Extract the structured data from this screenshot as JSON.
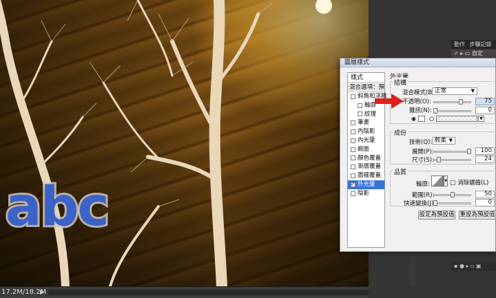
{
  "canvas": {
    "overlay_text": "abc"
  },
  "status_bar": {
    "doc_size": "17.2M/18.2M"
  },
  "right_panel": {
    "tab1": "動作",
    "tab2": "步驟記錄",
    "row_label": "自定"
  },
  "dialog": {
    "title": "圖層樣式",
    "style_list": {
      "header": "樣式",
      "blend_options": "混合選項：預設",
      "items": [
        {
          "label": "斜角和浮雕",
          "checked": false,
          "sub": false,
          "selected": false
        },
        {
          "label": "輪廓",
          "checked": false,
          "sub": true,
          "selected": false
        },
        {
          "label": "紋理",
          "checked": false,
          "sub": true,
          "selected": false
        },
        {
          "label": "筆畫",
          "checked": false,
          "sub": false,
          "selected": false
        },
        {
          "label": "內陰影",
          "checked": false,
          "sub": false,
          "selected": false
        },
        {
          "label": "內光暈",
          "checked": false,
          "sub": false,
          "selected": false
        },
        {
          "label": "緞面",
          "checked": false,
          "sub": false,
          "selected": false
        },
        {
          "label": "顏色覆蓋",
          "checked": false,
          "sub": false,
          "selected": false
        },
        {
          "label": "漸層覆蓋",
          "checked": false,
          "sub": false,
          "selected": false
        },
        {
          "label": "圖樣覆蓋",
          "checked": false,
          "sub": false,
          "selected": false
        },
        {
          "label": "外光暈",
          "checked": true,
          "sub": false,
          "selected": true
        },
        {
          "label": "陰影",
          "checked": false,
          "sub": false,
          "selected": false
        }
      ]
    },
    "outer_glow": {
      "title": "外光暈",
      "structure": {
        "title": "結構",
        "blend_mode_label": "混合模式(B):",
        "blend_mode_value": "正常",
        "opacity_label": "不透明(O):",
        "opacity_value": "75",
        "opacity_fraction": 0.75,
        "noise_label": "雜訊(N):",
        "noise_value": "0",
        "noise_fraction": 0.0
      },
      "elements": {
        "title": "成份",
        "technique_label": "技術(Q):",
        "technique_value": "較柔",
        "spread_label": "展開(P):",
        "spread_value": "100",
        "spread_fraction": 1.0,
        "size_label": "尺寸(S):",
        "size_value": "24",
        "size_fraction": 0.1
      },
      "quality": {
        "title": "品質",
        "contour_label": "輪廓:",
        "antialias_label": "消除鋸齒(L)",
        "range_label": "範圍(R):",
        "range_value": "50",
        "range_fraction": 0.5,
        "jitter_label": "快速變換(J):",
        "jitter_value": "0",
        "jitter_fraction": 0.0
      },
      "buttons": {
        "make_default": "設定為預設值",
        "reset_default": "重設為預設值"
      }
    }
  },
  "colors": {
    "glow_color": "#ffffff",
    "text_color": "#3a62c8",
    "selection": "#3874d8",
    "arrow": "#e0201a"
  }
}
